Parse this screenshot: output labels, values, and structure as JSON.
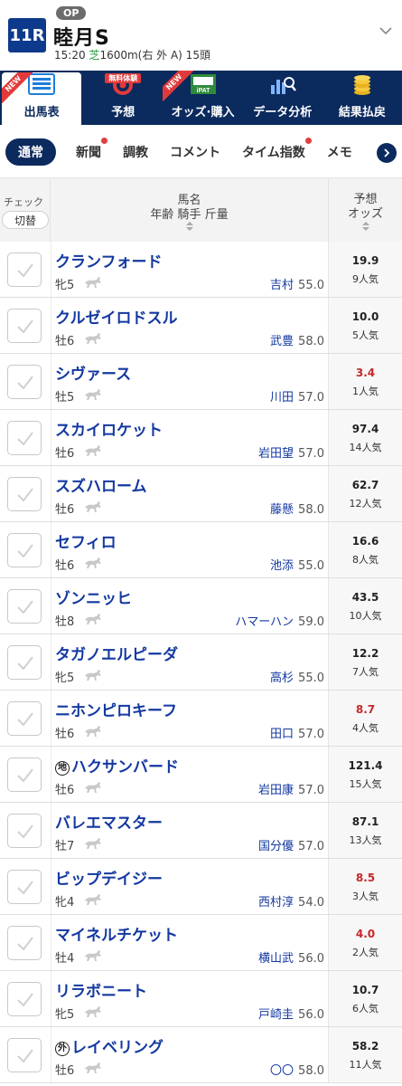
{
  "race": {
    "number": "11R",
    "grade": "OP",
    "name": "睦月S",
    "time": "15:20",
    "surface": "芝",
    "details": "1600m(右 外 A) 15頭"
  },
  "main_nav": [
    {
      "label": "出馬表",
      "icon": "race-card-icon",
      "new": true,
      "free": false,
      "active": true
    },
    {
      "label": "予想",
      "icon": "target-icon",
      "new": false,
      "free": true,
      "active": false
    },
    {
      "label": "オッズ·購入",
      "icon": "ipat-icon",
      "new": true,
      "free": false,
      "active": false
    },
    {
      "label": "データ分析",
      "icon": "chart-search-icon",
      "new": false,
      "free": false,
      "active": false
    },
    {
      "label": "結果払戻",
      "icon": "coins-icon",
      "new": false,
      "free": false,
      "active": false
    }
  ],
  "new_badge": "NEW",
  "free_badge": "無料体験",
  "sub_tabs": [
    {
      "label": "通常",
      "active": true,
      "dot": false
    },
    {
      "label": "新聞",
      "active": false,
      "dot": true
    },
    {
      "label": "調教",
      "active": false,
      "dot": false
    },
    {
      "label": "コメント",
      "active": false,
      "dot": false
    },
    {
      "label": "タイム指数",
      "active": false,
      "dot": true
    },
    {
      "label": "メモ",
      "active": false,
      "dot": false
    }
  ],
  "table_head": {
    "check_label": "チェック",
    "toggle_label": "切替",
    "name_label": "馬名",
    "sub_label": "年齢 騎手 斤量",
    "odds_label_1": "予想",
    "odds_label_2": "オッズ"
  },
  "horses": [
    {
      "name": "クランフォード",
      "mark": "",
      "sexage": "牝5",
      "jockey": "吉村",
      "weight": "55.0",
      "odds": "19.9",
      "pop": "9人気",
      "hot": false
    },
    {
      "name": "クルゼイロドスル",
      "mark": "",
      "sexage": "牡6",
      "jockey": "武豊",
      "weight": "58.0",
      "odds": "10.0",
      "pop": "5人気",
      "hot": false
    },
    {
      "name": "シヴァース",
      "mark": "",
      "sexage": "牡5",
      "jockey": "川田",
      "weight": "57.0",
      "odds": "3.4",
      "pop": "1人気",
      "hot": true
    },
    {
      "name": "スカイロケット",
      "mark": "",
      "sexage": "牡6",
      "jockey": "岩田望",
      "weight": "57.0",
      "odds": "97.4",
      "pop": "14人気",
      "hot": false
    },
    {
      "name": "スズハローム",
      "mark": "",
      "sexage": "牡6",
      "jockey": "藤懸",
      "weight": "58.0",
      "odds": "62.7",
      "pop": "12人気",
      "hot": false
    },
    {
      "name": "セフィロ",
      "mark": "",
      "sexage": "牡6",
      "jockey": "池添",
      "weight": "55.0",
      "odds": "16.6",
      "pop": "8人気",
      "hot": false
    },
    {
      "name": "ゾンニッヒ",
      "mark": "",
      "sexage": "牡8",
      "jockey": "ハマーハン",
      "weight": "59.0",
      "odds": "43.5",
      "pop": "10人気",
      "hot": false
    },
    {
      "name": "タガノエルピーダ",
      "mark": "",
      "sexage": "牝5",
      "jockey": "高杉",
      "weight": "55.0",
      "odds": "12.2",
      "pop": "7人気",
      "hot": false
    },
    {
      "name": "ニホンピロキーフ",
      "mark": "",
      "sexage": "牡6",
      "jockey": "田口",
      "weight": "57.0",
      "odds": "8.7",
      "pop": "4人気",
      "hot": true
    },
    {
      "name": "ハクサンバード",
      "mark": "地",
      "sexage": "牡6",
      "jockey": "岩田康",
      "weight": "57.0",
      "odds": "121.4",
      "pop": "15人気",
      "hot": false
    },
    {
      "name": "バレエマスター",
      "mark": "",
      "sexage": "牡7",
      "jockey": "国分優",
      "weight": "57.0",
      "odds": "87.1",
      "pop": "13人気",
      "hot": false
    },
    {
      "name": "ビップデイジー",
      "mark": "",
      "sexage": "牝4",
      "jockey": "西村淳",
      "weight": "54.0",
      "odds": "8.5",
      "pop": "3人気",
      "hot": true
    },
    {
      "name": "マイネルチケット",
      "mark": "",
      "sexage": "牡4",
      "jockey": "横山武",
      "weight": "56.0",
      "odds": "4.0",
      "pop": "2人気",
      "hot": true
    },
    {
      "name": "リラボニート",
      "mark": "",
      "sexage": "牝5",
      "jockey": "戸崎圭",
      "weight": "56.0",
      "odds": "10.7",
      "pop": "6人気",
      "hot": false
    },
    {
      "name": "レイベリング",
      "mark": "外",
      "sexage": "牡6",
      "jockey": "〇〇",
      "weight": "58.0",
      "odds": "58.2",
      "pop": "11人気",
      "hot": false
    }
  ],
  "colors": {
    "navy": "#0b2a5e",
    "race_num_bg": "#0d3a8c",
    "horse_name": "#1338a0",
    "hot_odds": "#c62828",
    "badge_red": "#e23a3a"
  }
}
